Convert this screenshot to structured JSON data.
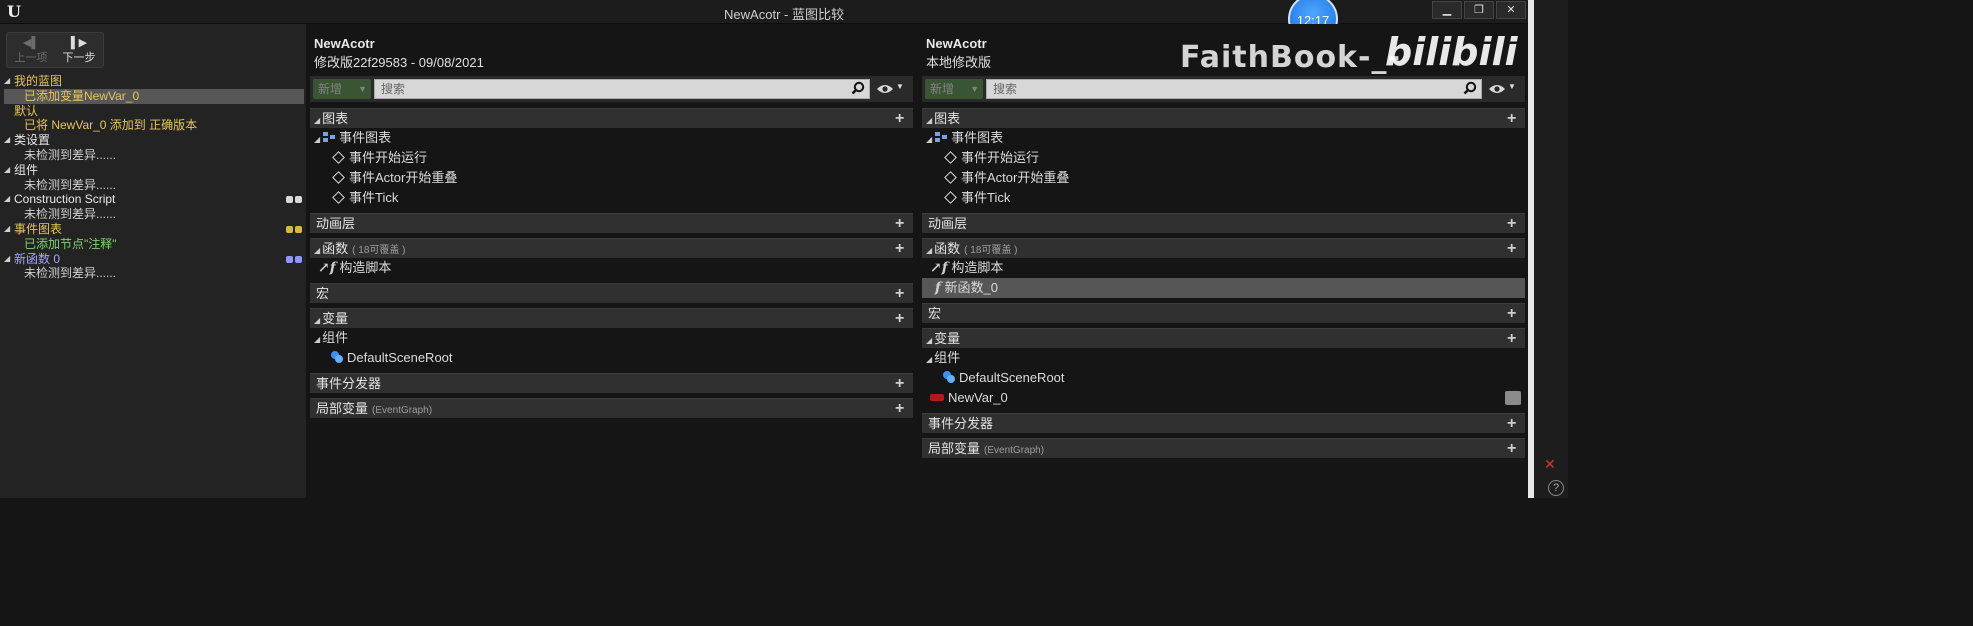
{
  "window": {
    "title": "NewAcotr - 蓝图比较",
    "controls": [
      "minimize-icon",
      "restore-icon",
      "close-icon"
    ],
    "clock": "12:17"
  },
  "nav": {
    "prev_label": "上一项",
    "next_label": "下一步"
  },
  "diff_list": [
    {
      "text": "我的蓝图",
      "kind": "cat",
      "color": "yellow"
    },
    {
      "text": "已添加变量NewVar_0",
      "kind": "child",
      "color": "yellow",
      "selected": true
    },
    {
      "text": "默认",
      "kind": "cat-plain",
      "color": "yellow"
    },
    {
      "text": "已将 NewVar_0 添加到 正确版本",
      "kind": "child",
      "color": "yellow"
    },
    {
      "text": "类设置",
      "kind": "cat"
    },
    {
      "text": "未检测到差异......",
      "kind": "child"
    },
    {
      "text": "组件",
      "kind": "cat"
    },
    {
      "text": "未检测到差异......",
      "kind": "child"
    },
    {
      "text": "Construction Script",
      "kind": "cat",
      "dots": [
        "#d9d9d9",
        "#d9d9d9"
      ]
    },
    {
      "text": "未检测到差异......",
      "kind": "child"
    },
    {
      "text": "事件图表",
      "kind": "cat",
      "color": "yellow",
      "dots": [
        "#d6b84a",
        "#d6b84a"
      ]
    },
    {
      "text": "已添加节点\"注释\"",
      "kind": "child",
      "color": "green"
    },
    {
      "text": "新函数 0",
      "kind": "cat",
      "color": "blue",
      "dots": [
        "#8e96ff",
        "#8e96ff"
      ]
    },
    {
      "text": "未检测到差异......",
      "kind": "child"
    }
  ],
  "panels": {
    "left": {
      "name": "NewAcotr",
      "revision": "修改版22f29583 - 09/08/2021",
      "add_label": "新增",
      "search_placeholder": "搜索",
      "sections": {
        "graphs": "图表",
        "event_graph": "事件图表",
        "events": [
          "事件开始运行",
          "事件Actor开始重叠",
          "事件Tick"
        ],
        "anim_layers": "动画层",
        "functions": "函数",
        "functions_note": "( 18可覆盖 )",
        "construction_script": "构造脚本",
        "macros": "宏",
        "variables": "变量",
        "components": "组件",
        "default_scene_root": "DefaultSceneRoot",
        "dispatchers": "事件分发器",
        "local_vars": "局部变量",
        "local_vars_note": "(EventGraph)"
      }
    },
    "right": {
      "name": "NewAcotr",
      "revision": "本地修改版",
      "add_label": "新增",
      "search_placeholder": "搜索",
      "sections": {
        "graphs": "图表",
        "event_graph": "事件图表",
        "events": [
          "事件开始运行",
          "事件Actor开始重叠",
          "事件Tick"
        ],
        "anim_layers": "动画层",
        "functions": "函数",
        "functions_note": "( 18可覆盖 )",
        "construction_script": "构造脚本",
        "new_function": "新函数_0",
        "macros": "宏",
        "variables": "变量",
        "components": "组件",
        "default_scene_root": "DefaultSceneRoot",
        "new_var": "NewVar_0",
        "dispatchers": "事件分发器",
        "local_vars": "局部变量",
        "local_vars_note": "(EventGraph)"
      }
    }
  },
  "watermark": {
    "text": "FaithBook-_-",
    "logo": "bilibili"
  }
}
